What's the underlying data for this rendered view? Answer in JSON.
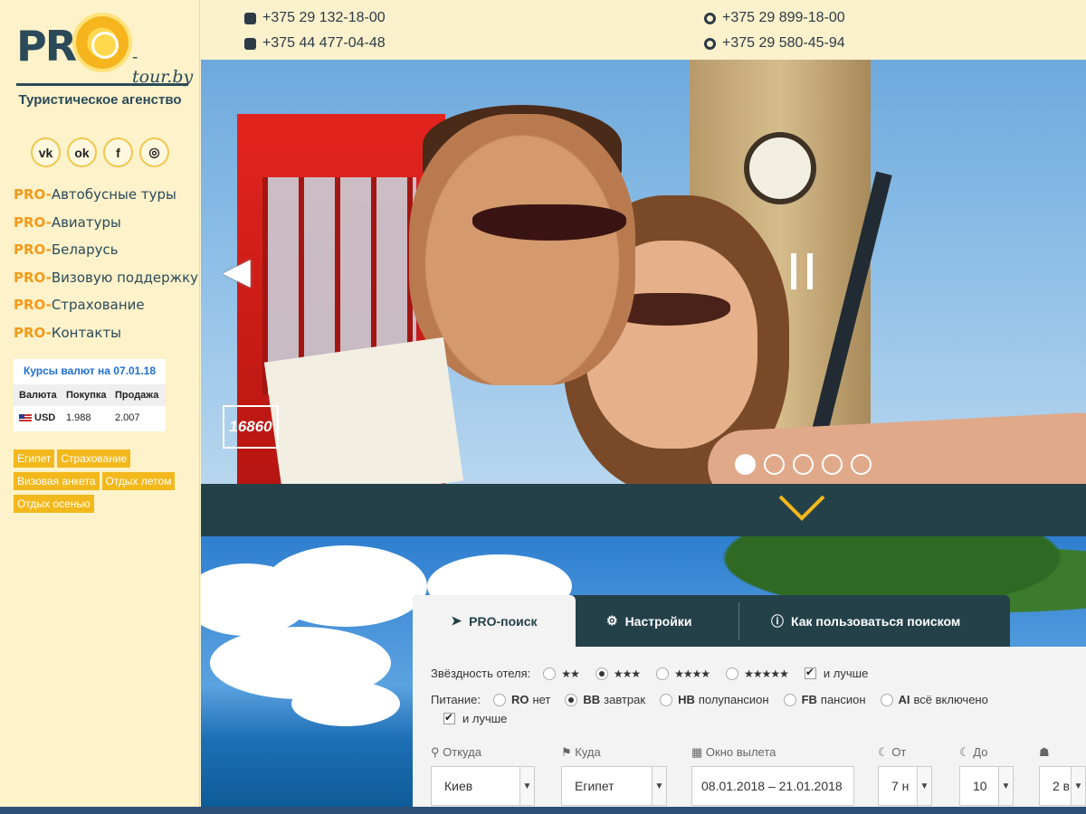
{
  "logo": {
    "pro": "PRO",
    "tour": "- tour.by"
  },
  "tagline": "Туристическое агенство",
  "socials": [
    {
      "icon": "vk-icon",
      "glyph": "vk"
    },
    {
      "icon": "odnoklassniki-icon",
      "glyph": "ok"
    },
    {
      "icon": "facebook-icon",
      "glyph": "f"
    },
    {
      "icon": "instagram-icon",
      "glyph": "◎"
    }
  ],
  "menu": {
    "prefix": "PRO-",
    "items": [
      "Автобусные туры",
      "Авиатуры",
      "Беларусь",
      "Визовую поддержку",
      "Страхование",
      "Контакты"
    ]
  },
  "rates": {
    "title": "Курсы валют на 07.01.18",
    "headers": [
      "Валюта",
      "Покупка",
      "Продажа"
    ],
    "row": {
      "currency": "USD",
      "buy": "1.988",
      "sell": "2.007"
    }
  },
  "tags": [
    "Египет",
    "Страхование",
    "Визовая анкета",
    "Отдых летом",
    "Отдых осенью"
  ],
  "phones": {
    "viber1": "+375 29 132-18-00",
    "viber2": "+375 44 477-04-48",
    "mts1": "+375 29 899-18-00",
    "mts2": "+375 29 580-45-94"
  },
  "slider": {
    "counter": "16860",
    "prev_glyph": "◀",
    "slide_count": 5,
    "active_slide": 1
  },
  "search": {
    "tabs": {
      "search": "PRO-поиск",
      "settings": "Настройки",
      "help": "Как пользоваться поиском"
    },
    "stars_label": "Звёздность отеля:",
    "stars": [
      "★★",
      "★★★",
      "★★★★",
      "★★★★★"
    ],
    "stars_selected": 1,
    "better": "и лучше",
    "meal_label": "Питание:",
    "meals": [
      {
        "code": "RO",
        "name": "нет"
      },
      {
        "code": "BB",
        "name": "завтрак"
      },
      {
        "code": "HB",
        "name": "полупансион"
      },
      {
        "code": "FB",
        "name": "пансион"
      },
      {
        "code": "AI",
        "name": "всё включено"
      }
    ],
    "meal_selected": 1,
    "fields": {
      "from_label": "Откуда",
      "from_value": "Киев",
      "to_label": "Куда",
      "to_value": "Египет",
      "dates_label": "Окно вылета",
      "dates_value": "08.01.2018 – 21.01.2018",
      "nights_from_label": "От",
      "nights_from_value": "7 н",
      "nights_to_label": "До",
      "nights_to_value": "10",
      "adults_value": "2 в"
    }
  }
}
